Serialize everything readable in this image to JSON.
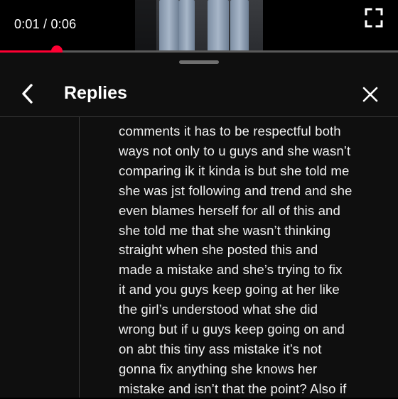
{
  "player": {
    "time_current": "0:01",
    "time_separator": " / ",
    "time_total": "0:06",
    "progress_fraction": 0.143,
    "accent_color": "#ff0033"
  },
  "icons": {
    "fullscreen": "fullscreen-icon",
    "back": "chevron-left-icon",
    "close": "close-icon"
  },
  "sheet": {
    "title": "Replies",
    "reply_lines": [
      "comments it has to be respectful both",
      "ways not only to u guys and she wasn’t",
      "comparing ik it kinda is but she told me",
      "she was jst following and trend and she",
      "even blames herself for all of this and",
      "she told me that she wasn’t thinking",
      "straight when she posted this and",
      "made a mistake and she’s trying to fix",
      "it and you guys keep going at her like",
      "the girl’s understood what she did",
      "wrong but if u guys keep going on and",
      "on abt this tiny ass mistake it’s not",
      "gonna fix anything she knows her",
      "mistake and isn’t that the point? Also if"
    ]
  }
}
